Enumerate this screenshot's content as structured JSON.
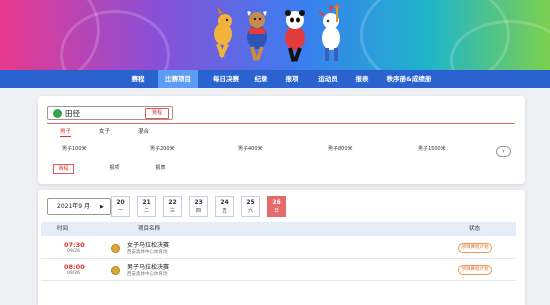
{
  "nav": {
    "items": [
      "赛程",
      "比赛项目",
      "每日决赛",
      "纪录",
      "报项",
      "运动员",
      "报表",
      "秩序册&成绩册"
    ],
    "active_index": 1
  },
  "sport_filter": {
    "selected": "田径",
    "action_button": "赛程"
  },
  "gender_tabs": [
    "男子",
    "女子",
    "混合"
  ],
  "gender_active_index": 0,
  "events": [
    "男子100米",
    "男子200米",
    "男子400米",
    "男子800米",
    "男子1500米"
  ],
  "view_tabs": [
    "赛程",
    "报项",
    "报表"
  ],
  "view_active_index": 0,
  "calendar": {
    "month_label": "2021年9 月",
    "days": [
      {
        "num": "20",
        "weekday": "一"
      },
      {
        "num": "21",
        "weekday": "二"
      },
      {
        "num": "22",
        "weekday": "三"
      },
      {
        "num": "23",
        "weekday": "四"
      },
      {
        "num": "24",
        "weekday": "五"
      },
      {
        "num": "25",
        "weekday": "六"
      },
      {
        "num": "26",
        "weekday": "日"
      }
    ],
    "active_index": 6
  },
  "table": {
    "headers": {
      "time": "时间",
      "event": "项目名称",
      "status": "状态"
    },
    "rows": [
      {
        "time": "07:30",
        "date": "09/26",
        "event": "女子马拉松决赛",
        "venue": "西安奥体中心体育场",
        "status": "项目赛程计划"
      },
      {
        "time": "08:00",
        "date": "09/26",
        "event": "男子马拉松决赛",
        "venue": "西安奥体中心体育场",
        "status": "项目赛程计划"
      }
    ]
  },
  "icons": {
    "sport": "athletics-icon",
    "medal": "medal-icon",
    "next": "chevron-right-icon",
    "dropdown": "caret-right-icon"
  },
  "colors": {
    "nav": "#2a62cf",
    "nav_active": "#5c9cf4",
    "accent_red": "#e56a6a",
    "status_orange": "#e36b1f"
  }
}
